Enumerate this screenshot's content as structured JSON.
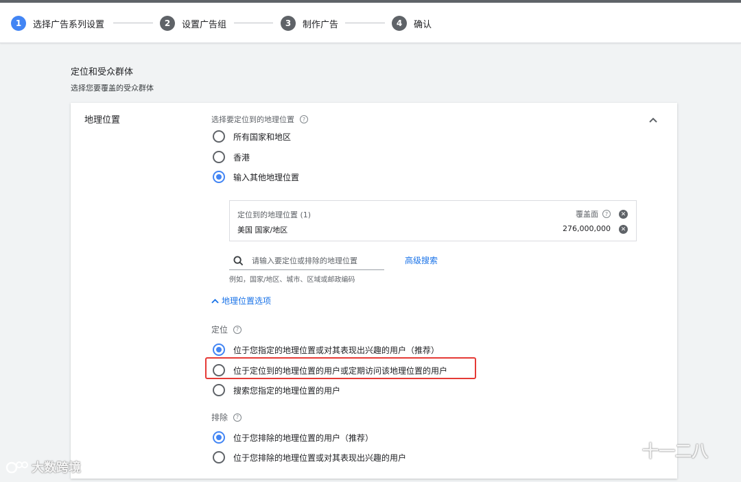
{
  "stepper": {
    "steps": [
      {
        "num": "1",
        "label": "选择广告系列设置"
      },
      {
        "num": "2",
        "label": "设置广告组"
      },
      {
        "num": "3",
        "label": "制作广告"
      },
      {
        "num": "4",
        "label": "确认"
      }
    ]
  },
  "section": {
    "title": "定位和受众群体",
    "subtitle": "选择您要覆盖的受众群体"
  },
  "location_card": {
    "label": "地理位置",
    "question": "选择要定位到的地理位置",
    "options": [
      "所有国家和地区",
      "香港",
      "输入其他地理位置"
    ],
    "selected_option": "输入其他地理位置",
    "targets": {
      "header": "定位到的地理位置 (1)",
      "reach_label": "覆盖面",
      "item_name": "美国 国家/地区",
      "item_reach": "276,000,000"
    },
    "search": {
      "placeholder": "请输入要定位或排除的地理位置",
      "advanced_link": "高级搜索",
      "hint": "例如，国家/地区、城市、区域或邮政编码"
    },
    "options_toggle": "地理位置选项",
    "targeting": {
      "label": "定位",
      "options": [
        "位于您指定的地理位置或对其表现出兴趣的用户（推荐）",
        "位于定位到的地理位置的用户或定期访问该地理位置的用户",
        "搜索您指定的地理位置的用户"
      ],
      "selected_option": "位于您指定的地理位置或对其表现出兴趣的用户（推荐）"
    },
    "exclusion": {
      "label": "排除",
      "options": [
        "位于您排除的地理位置的用户（推荐）",
        "位于您排除的地理位置或对其表现出兴趣的用户"
      ],
      "selected_option": "位于您排除的地理位置的用户（推荐）"
    }
  },
  "watermarks": {
    "left": "大数跨境",
    "right": "十一二八"
  },
  "colors": {
    "accent": "#4285f4",
    "link": "#1a73e8",
    "highlight": "#e53935"
  }
}
